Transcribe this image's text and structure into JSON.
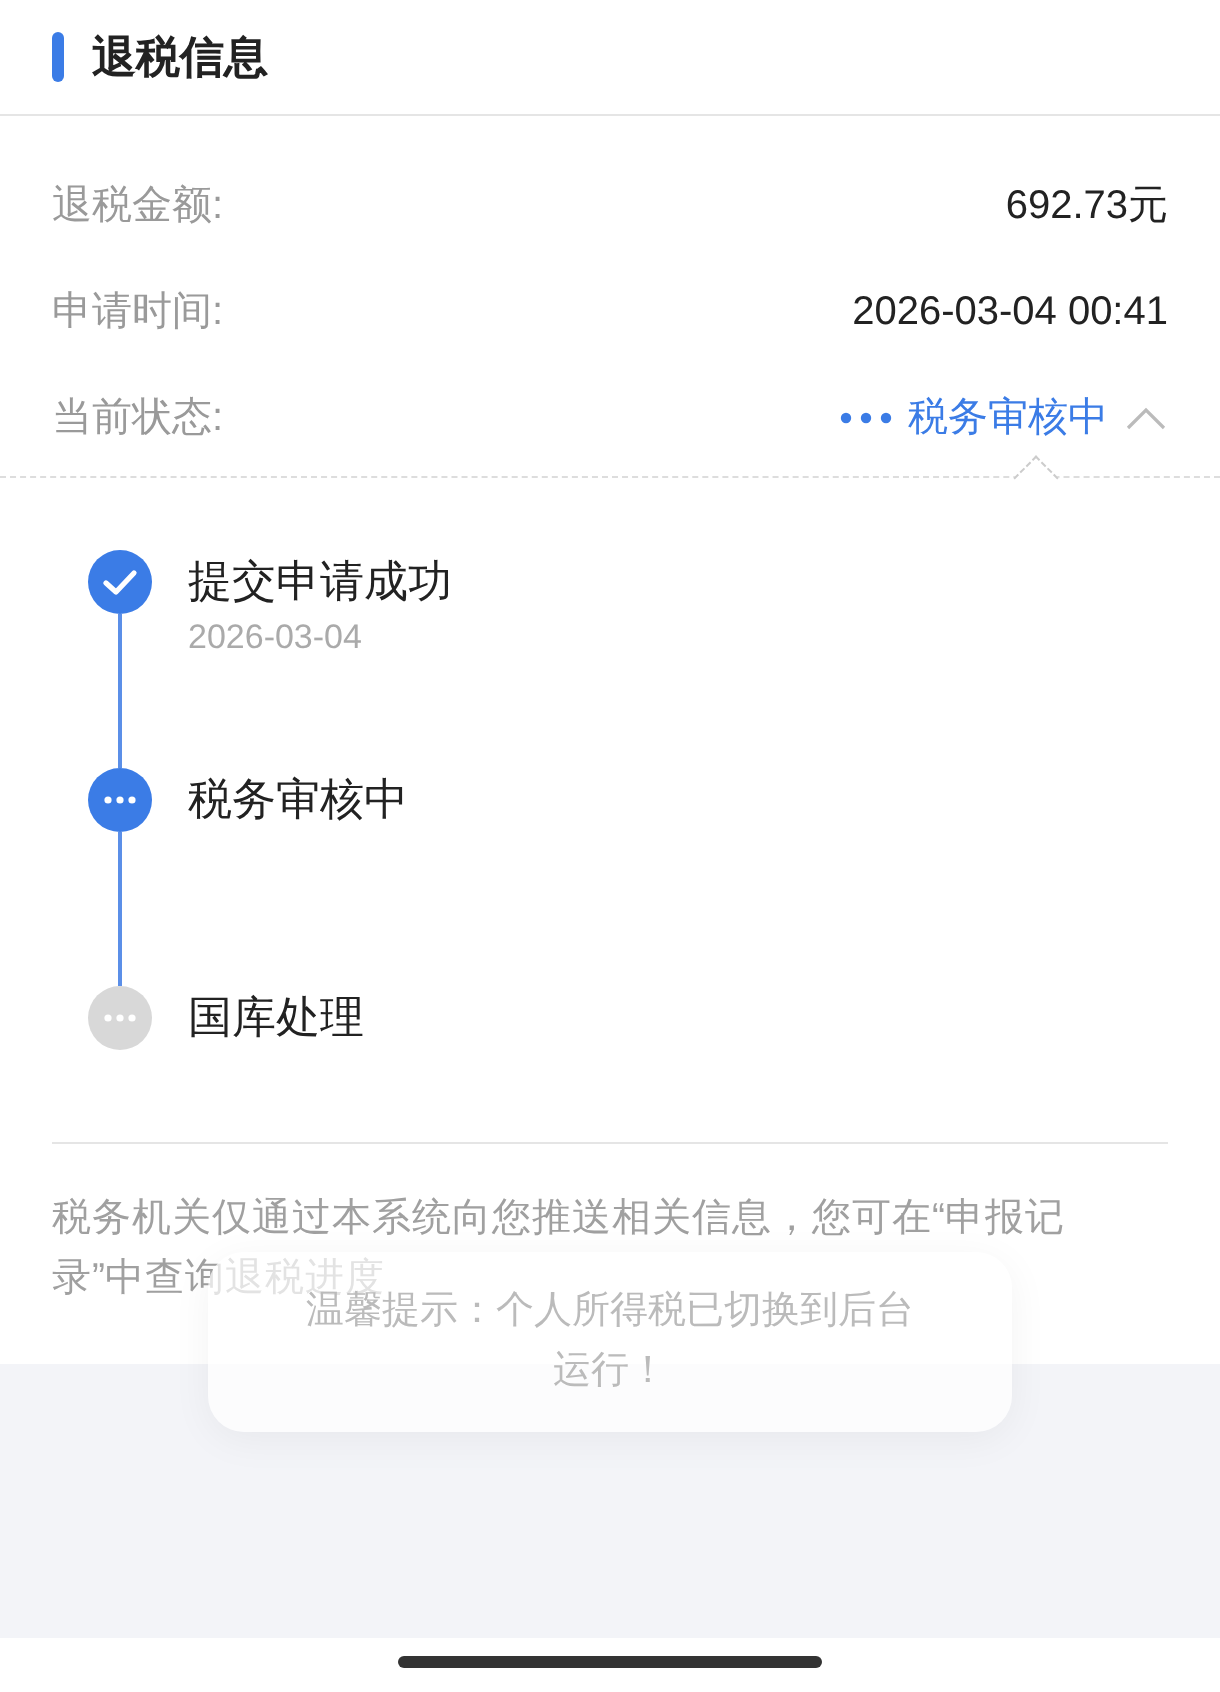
{
  "section_title": "退税信息",
  "details": [
    {
      "label": "退税金额:",
      "value": "692.73元",
      "kind": "text"
    },
    {
      "label": "申请时间:",
      "value": "2026-03-04 00:41",
      "kind": "text"
    },
    {
      "label": "当前状态:",
      "value": "税务审核中",
      "kind": "status",
      "expanded": true
    }
  ],
  "steps": [
    {
      "title": "提交申请成功",
      "date": "2026-03-04",
      "kind": "done"
    },
    {
      "title": "税务审核中",
      "kind": "current"
    },
    {
      "title": "国库处理",
      "kind": "pending"
    }
  ],
  "notice": "税务机关仅通过本系统向您推送相关信息，您可在“申报记录”中查询退税进度",
  "toast": "温馨提示：个人所得税已切换到后台运行！"
}
